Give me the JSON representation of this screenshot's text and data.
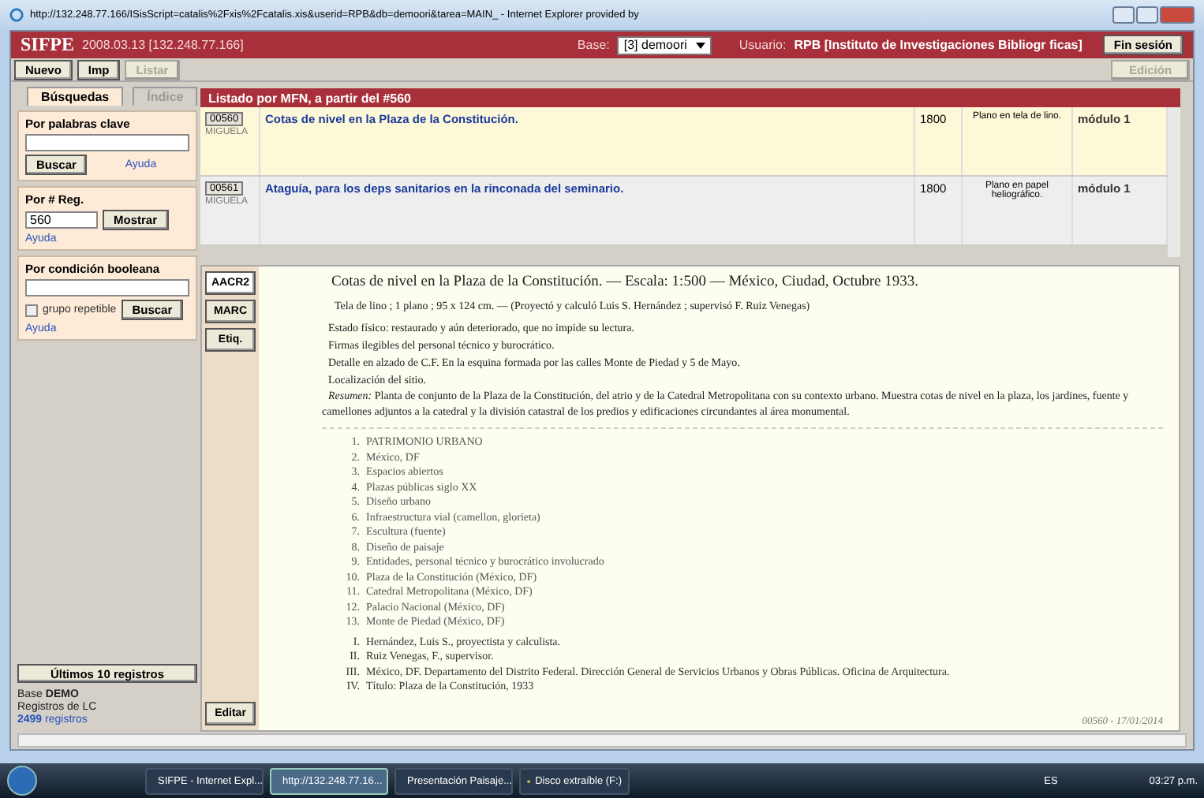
{
  "browser": {
    "title": "http://132.248.77.166/ISisScript=catalis%2Fxis%2Fcatalis.xis&userid=RPB&db=demoori&tarea=MAIN_ - Internet Explorer provided by"
  },
  "header": {
    "app_name": "SIFPE",
    "version": "2008.03.13 [132.248.77.166]",
    "base_label": "Base:",
    "base_value": "[3] demoori",
    "user_label": "Usuario:",
    "user_value": "RPB [Instituto de Investigaciones Bibliogr ficas]",
    "logout": "Fin sesión"
  },
  "toolbar": {
    "buttons": [
      {
        "label": "Nuevo",
        "disabled": false
      },
      {
        "label": "Imp",
        "disabled": false
      },
      {
        "label": "Listar",
        "disabled": true
      }
    ],
    "edit_button": {
      "label": "Edición",
      "disabled": true
    }
  },
  "sidebar": {
    "tabs": [
      {
        "label": "Búsquedas",
        "selected": true
      },
      {
        "label": "Índice",
        "selected": false
      }
    ],
    "sections": [
      {
        "kind": "keyword",
        "label": "Por palabras clave",
        "button": "Buscar",
        "help": "Ayuda"
      },
      {
        "kind": "record",
        "label": "Por # Reg.",
        "value": "560",
        "button": "Mostrar",
        "help": "Ayuda"
      },
      {
        "kind": "boolean",
        "label": "Por condición booleana",
        "checkbox": {
          "label": "grupo repetible",
          "checked": false
        },
        "button": "Buscar",
        "help": "Ayuda"
      }
    ],
    "recent_button": "Últimos 10 registros",
    "base_label": "Base",
    "base_name": "DEMO",
    "collection": "Registros de LC",
    "count": "2499",
    "count_label": "registros"
  },
  "listing": {
    "title": "Listado por MFN, a partir del #560",
    "rows": [
      {
        "id": "00560",
        "user": "MIGUELA",
        "title": "Cotas de nivel en la Plaza de la Constitución.",
        "year": "1800",
        "description": "Plano en tela de lino.",
        "location": "módulo 1",
        "selected": true
      },
      {
        "id": "00561",
        "user": "MIGUELA",
        "title": "Ataguía, para los deps sanitarios en la rinconada del seminario.",
        "year": "1800",
        "description": "Plano en papel heliográfico.",
        "location": "módulo 1",
        "selected": false
      }
    ]
  },
  "detail": {
    "formats": [
      {
        "label": "AACR2",
        "selected": true
      },
      {
        "label": "MARC",
        "selected": false
      },
      {
        "label": "Etiq.",
        "selected": false
      }
    ],
    "edit_button": "Editar",
    "heading": "Cotas de nivel en la Plaza de la Constitución. — Escala: 1:500 — México, Ciudad, Octubre 1933.",
    "physical": "Tela de lino ; 1 plano ; 95 x 124 cm. — (Proyectó y calculó Luis S. Hernández ; supervisó F. Ruiz Venegas)",
    "notes": [
      "Estado físico: restaurado y aún deteriorado, que no impide su lectura.",
      "Firmas ilegibles del personal técnico y burocrático.",
      "Detalle en alzado de C.F. En la esquina formada por las calles Monte de Piedad y 5 de Mayo.",
      "Localización del sitio."
    ],
    "summary": "*Resumen:* Planta de conjunto de la Plaza de la Constitución, del atrio y de la Catedral Metropolitana con su contexto urbano. Muestra cotas de nivel en la plaza, los jardines, fuente y camellones adjuntos a la catedral y la división catastral de los predios y edificaciones circundantes al área monumental.",
    "subjects": [
      {
        "number": "1.",
        "text": "PATRIMONIO URBANO"
      },
      {
        "number": "2.",
        "text": "México, DF"
      },
      {
        "number": "3.",
        "text": "Espacios abiertos"
      },
      {
        "number": "4.",
        "text": "Plazas públicas siglo XX"
      },
      {
        "number": "5.",
        "text": "Diseño urbano"
      },
      {
        "number": "6.",
        "text": "Infraestructura vial (camellon, glorieta)"
      },
      {
        "number": "7.",
        "text": "Escultura (fuente)"
      },
      {
        "number": "8.",
        "text": "Diseño de paisaje"
      },
      {
        "number": "9.",
        "text": "Entidades, personal técnico y burocrático involucrado"
      },
      {
        "number": "10.",
        "text": "Plaza de la Constitución (México, DF)"
      },
      {
        "number": "11.",
        "text": "Catedral Metropolitana (México, DF)"
      },
      {
        "number": "12.",
        "text": "Palacio Nacional (México, DF)"
      },
      {
        "number": "13.",
        "text": "Monte de Piedad (México, DF)"
      }
    ],
    "entries": [
      {
        "number": "I.",
        "text": "Hernández, Luis S., proyectista y calculista."
      },
      {
        "number": "II.",
        "text": "Ruiz Venegas, F., supervisor."
      },
      {
        "number": "III.",
        "text": "México, DF. Departamento del Distrito Federal. Dirección General de Servicios Urbanos y Obras Públicas. Oficina de Arquitectura."
      },
      {
        "number": "IV.",
        "text": "Título: Plaza de la Constitución, 1933"
      }
    ],
    "footer": "00560 - 17/01/2014"
  },
  "taskbar": {
    "tasks": [
      {
        "label": "SIFPE - Internet Expl...",
        "kind": "browser",
        "selected": false
      },
      {
        "label": "http://132.248.77.16...",
        "kind": "browser",
        "selected": true
      },
      {
        "label": "Presentación Paisaje...",
        "kind": "slides",
        "selected": false
      },
      {
        "label": "Disco extraíble (F:)",
        "kind": "folder",
        "selected": false
      }
    ],
    "language": "ES",
    "clock": "03:27 p.m."
  }
}
